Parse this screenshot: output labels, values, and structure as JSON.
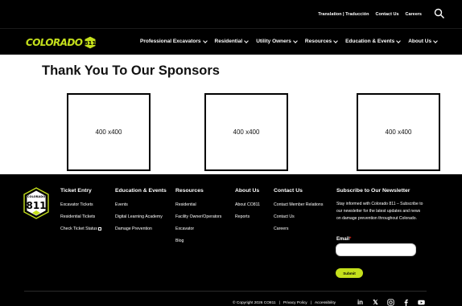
{
  "utility": {
    "translation": "Translation | Traducción",
    "contact": "Contact Us",
    "careers": "Careers"
  },
  "logo": {
    "text": "COLORADO",
    "badge": "811"
  },
  "nav": [
    {
      "label": "Professional Excavators"
    },
    {
      "label": "Residential"
    },
    {
      "label": "Utility Owners"
    },
    {
      "label": "Resources"
    },
    {
      "label": "Education & Events"
    },
    {
      "label": "About Us"
    }
  ],
  "sponsors": {
    "title": "Thank You To Our Sponsors",
    "items": [
      "400 x400",
      "400 x400",
      "400 x400"
    ]
  },
  "footer": {
    "logo_top": "COLORADO",
    "logo_num": "811",
    "ticket": {
      "title": "Ticket Entry",
      "links": [
        "Excavator Tickets",
        "Residential Tickets",
        "Check Ticket Status"
      ]
    },
    "education": {
      "title": "Education & Events",
      "links": [
        "Events",
        "Digital Learning Academy",
        "Damage Prevention"
      ]
    },
    "resources": {
      "title": "Resources",
      "links": [
        "Residential",
        "Facility Owner/Operators",
        "Excavator",
        "Blog"
      ]
    },
    "about": {
      "title": "About Us",
      "links": [
        "About CO811",
        "Reports"
      ]
    },
    "contact": {
      "title": "Contact Us",
      "links": [
        "Contact Member Relations",
        "Contact Us",
        "Careers"
      ]
    },
    "newsletter": {
      "title": "Subscribe to Our Newsletter",
      "desc": "Stay informed with Colorado 811 – Subscribe to our newsletter for the latest updates and news on damage prevention throughout Colorado.",
      "email_label": "Email",
      "submit": "Submit"
    },
    "copyright": "© Copyright 2026 CO811",
    "privacy": "Privacy Policy",
    "accessibility": "Accessibility",
    "social": {
      "linkedin": "in",
      "x": "𝕏"
    }
  },
  "colors": {
    "brand": "#c5e01c",
    "footer_bg": "#000000",
    "required": "#e2231a"
  },
  "icons": [
    "search-icon",
    "chevron-down-icon",
    "external-link-icon",
    "linkedin-icon",
    "x-icon",
    "instagram-icon",
    "facebook-icon",
    "youtube-icon"
  ]
}
